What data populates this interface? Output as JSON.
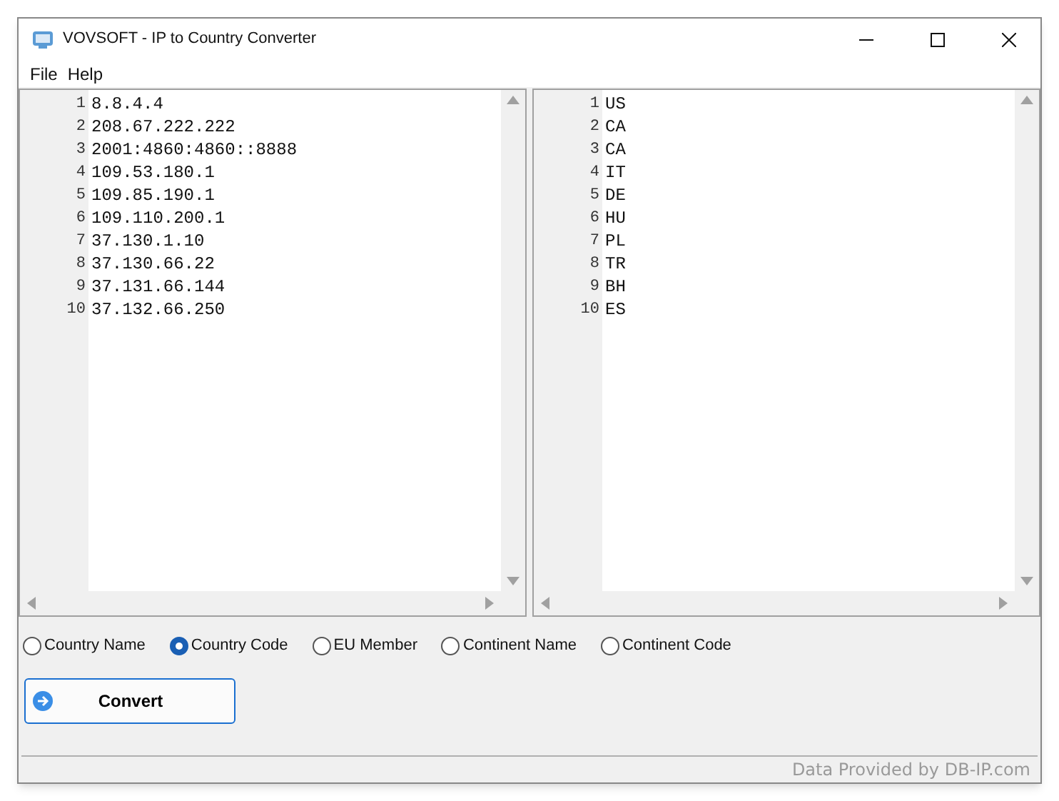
{
  "window": {
    "title": "VOVSOFT - IP to Country Converter"
  },
  "menu": [
    "File",
    "Help"
  ],
  "input_editor": {
    "lines": [
      {
        "number": "1",
        "text": "8.8.4.4"
      },
      {
        "number": "2",
        "text": "208.67.222.222"
      },
      {
        "number": "3",
        "text": "2001:4860:4860::8888"
      },
      {
        "number": "4",
        "text": "109.53.180.1"
      },
      {
        "number": "5",
        "text": "109.85.190.1"
      },
      {
        "number": "6",
        "text": "109.110.200.1"
      },
      {
        "number": "7",
        "text": "37.130.1.10"
      },
      {
        "number": "8",
        "text": "37.130.66.22"
      },
      {
        "number": "9",
        "text": "37.131.66.144"
      },
      {
        "number": "10",
        "text": "37.132.66.250"
      }
    ]
  },
  "output_editor": {
    "lines": [
      {
        "number": "1",
        "text": "US"
      },
      {
        "number": "2",
        "text": "CA"
      },
      {
        "number": "3",
        "text": "CA"
      },
      {
        "number": "4",
        "text": "IT"
      },
      {
        "number": "5",
        "text": "DE"
      },
      {
        "number": "6",
        "text": "HU"
      },
      {
        "number": "7",
        "text": "PL"
      },
      {
        "number": "8",
        "text": "TR"
      },
      {
        "number": "9",
        "text": "BH"
      },
      {
        "number": "10",
        "text": "ES"
      }
    ]
  },
  "options": [
    {
      "label": "Country Name",
      "selected": false
    },
    {
      "label": "Country Code",
      "selected": true
    },
    {
      "label": "EU Member",
      "selected": false
    },
    {
      "label": "Continent Name",
      "selected": false
    },
    {
      "label": "Continent Code",
      "selected": false
    }
  ],
  "convert_button": {
    "label": "Convert"
  },
  "status_bar": {
    "text": "Data Provided by DB-IP.com"
  }
}
